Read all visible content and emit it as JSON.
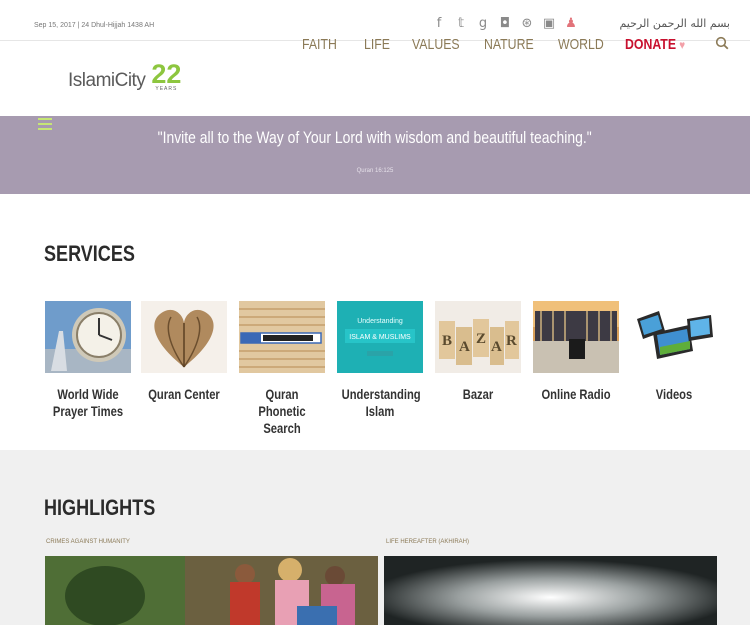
{
  "topbar": {
    "date": "Sep 15, 2017 | 24 Dhul-Hijjah 1438 AH",
    "social_icons": [
      "facebook-icon",
      "twitter-icon",
      "google-plus-icon",
      "instagram-icon",
      "pinterest-icon",
      "flickr-icon",
      "youtube-icon"
    ],
    "arabic_text": "بسم الله الرحمن الرحيم"
  },
  "header": {
    "logo_text": "IslamiCity",
    "logo_years_number": "22",
    "logo_years_label": "YEARS",
    "nav": [
      "FAITH",
      "LIFE",
      "VALUES",
      "NATURE",
      "WORLD"
    ],
    "donate": "DONATE",
    "donate_heart": "♥",
    "search_icon": "⚲"
  },
  "banner": {
    "quote": "\"Invite all to the Way of Your Lord with wisdom and beautiful teaching.\"",
    "citation": "Quran 16:125"
  },
  "services": {
    "title": "SERVICES",
    "items": [
      {
        "label": "World Wide Prayer Times",
        "icon": "clock-icon"
      },
      {
        "label": "Quran Center",
        "icon": "book-heart-icon"
      },
      {
        "label": "Quran Phonetic Search",
        "icon": "quran-search-icon"
      },
      {
        "label": "Understanding Islam",
        "icon": "understanding-islam-icon",
        "thumb_text": "Understanding ISLAM & MUSLIMS"
      },
      {
        "label": "Bazar",
        "icon": "bazar-tags-icon",
        "thumb_text": "BAZAR"
      },
      {
        "label": "Online Radio",
        "icon": "mecca-radio-icon"
      },
      {
        "label": "Videos",
        "icon": "film-reel-icon"
      }
    ]
  },
  "highlights": {
    "title": "HIGHLIGHTS",
    "items": [
      {
        "category": "CRIMES AGAINST HUMANITY"
      },
      {
        "category": "LIFE HEREAFTER (AKHIRAH)"
      }
    ]
  },
  "colors": {
    "banner": "#a79bb0",
    "nav_text": "#8b7a57",
    "donate": "#c8102e",
    "logo_green": "#8dc63f"
  }
}
